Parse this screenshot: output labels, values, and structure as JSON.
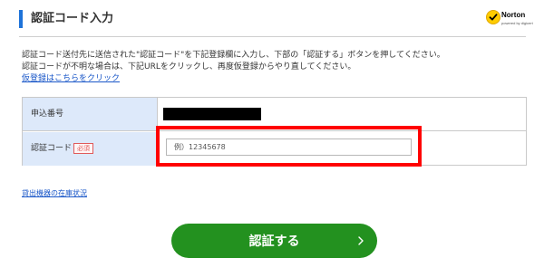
{
  "header": {
    "title": "認証コード入力",
    "norton_logo": {
      "brand": "Norton",
      "sub": "powered by digicert"
    }
  },
  "instructions": {
    "line1": "認証コード送付先に送信された\"認証コード\"を下記登録欄に入力し、下部の「認証する」ボタンを押してください。",
    "line2": "認証コードが不明な場合は、下記URLをクリックし、再度仮登録からやり直してください。",
    "reregister_link": "仮登録はこちらをクリック"
  },
  "form": {
    "application_number_label": "申込番号",
    "verification_code_label": "認証コード",
    "required_badge": "必須",
    "code_placeholder": "例）12345678",
    "code_value": ""
  },
  "stock_link": "貸出機器の在庫状況",
  "submit_button": {
    "label": "認証する",
    "icon": "chevron-right-icon"
  },
  "colors": {
    "accent_bar": "#1e73d9",
    "label_bg": "#dde9fa",
    "link": "#1a57c8",
    "required": "#e05a5a",
    "highlight": "#ff0000",
    "button": "#23911f"
  }
}
